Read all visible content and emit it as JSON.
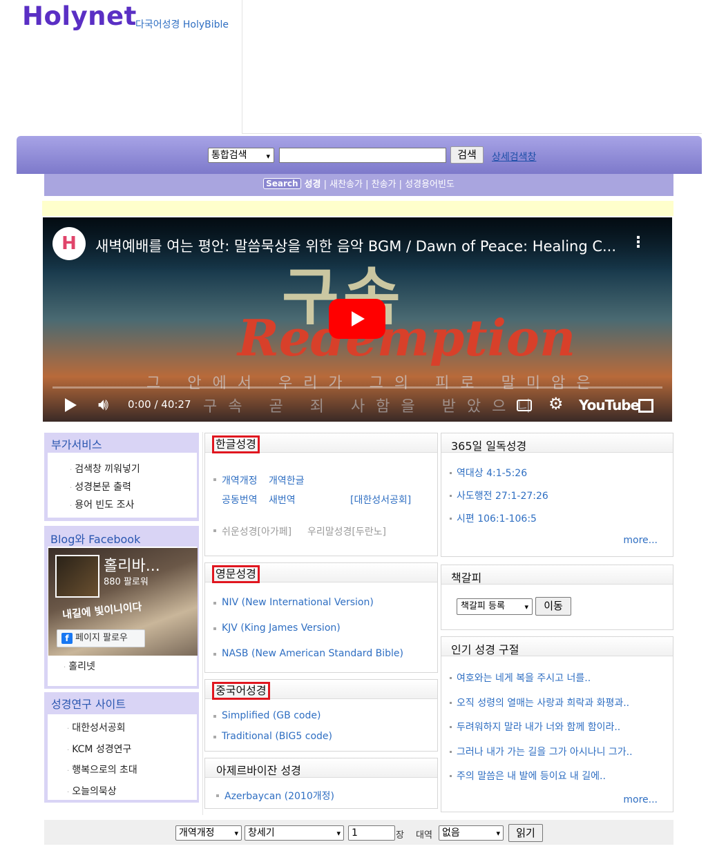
{
  "header": {
    "logo": "Holynet",
    "subtitle": "다국어성경 HolyBible"
  },
  "search": {
    "select_value": "통합검색",
    "button": "검색",
    "advanced_link": "상세검색창"
  },
  "menu": {
    "badge": "Search",
    "items": [
      "성경",
      "새찬송가",
      "찬송가",
      "성경용어빈도"
    ],
    "separator": " | "
  },
  "video": {
    "title": "새벽예배를 여는 평안: 말씀묵상을 위한 음악 BGM / Dawn of Peace: Healing C...",
    "overlay_korean": "구속",
    "overlay_english": "Redemption",
    "lyric_line1": "그 안에서 우리가 그의 피로 말미암은",
    "lyric_line2": "구속 곧 죄 사함을 받았으니",
    "time": "0:00 / 40:27",
    "brand": "YouTube"
  },
  "left": {
    "services": {
      "title": "부가서비스",
      "items": [
        "검색창 끼워넣기",
        "성경본문 출력",
        "용어 빈도 조사"
      ]
    },
    "blog": {
      "title": "Blog와 Facebook",
      "fb_name": "홀리바...",
      "fb_followers": "880 팔로워",
      "fb_art": "내길에 빛이니이다",
      "fb_button": "페이지 팔로우",
      "link": "홀리넷"
    },
    "research": {
      "title": "성경연구 사이트",
      "items": [
        "대한성서공회",
        "KCM 성경연구",
        "행복으로의 초대",
        "오늘의묵상"
      ]
    }
  },
  "middle": {
    "korean": {
      "title": "한글성경",
      "row1": [
        "개역개정",
        "개역한글"
      ],
      "row2": [
        "공동번역",
        "새번역"
      ],
      "publisher": "[대한성서공회]",
      "row3": [
        "쉬운성경[아가페]",
        "우리말성경[두란노]"
      ]
    },
    "english": {
      "title": "영문성경",
      "items": [
        "NIV (New International Version)",
        "KJV (King James Version)",
        "NASB (New American Standard Bible)"
      ]
    },
    "chinese": {
      "title": "중국어성경",
      "items": [
        "Simplified (GB code)",
        "Traditional (BIG5 code)"
      ]
    },
    "azerbaijani": {
      "title": "아제르바이잔 성경",
      "items": [
        "Azerbaycan (2010개정)"
      ]
    }
  },
  "right": {
    "daily": {
      "title": "365일 일독성경",
      "items": [
        "역대상 4:1-5:26",
        "사도행전 27:1-27:26",
        "시편 106:1-106:5"
      ],
      "more": "more..."
    },
    "bookmark": {
      "title": "책갈피",
      "select_value": "책갈피 등록",
      "button": "이동"
    },
    "popular": {
      "title": "인기 성경 구절",
      "items": [
        "여호와는 네게 복을 주시고 너를..",
        "오직 성령의 열매는 사랑과 희락과 화평과..",
        "두려워하지 말라 내가 너와 함께 함이라..",
        "그러나 내가 가는 길을 그가 아시나니 그가..",
        "주의 말씀은 내 발에 등이요 내 길에.."
      ],
      "more": "more..."
    }
  },
  "bottom": {
    "version": "개역개정",
    "book": "창세기",
    "chapter": "1",
    "chapter_label": "장",
    "compare_label": "대역",
    "compare_value": "없음",
    "read_button": "읽기"
  }
}
